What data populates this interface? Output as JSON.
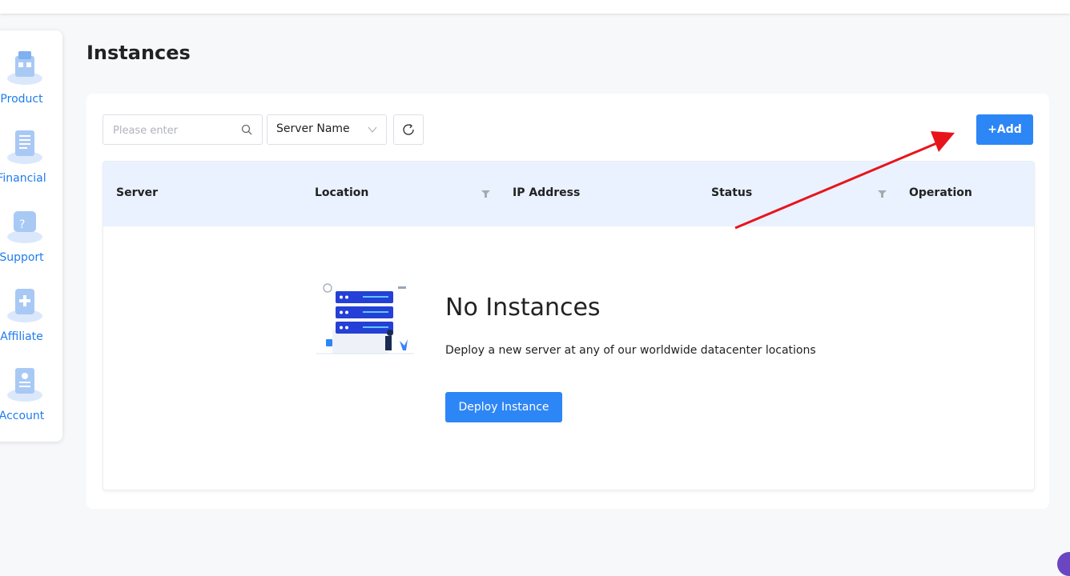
{
  "page": {
    "title": "Instances"
  },
  "sidebar": {
    "items": [
      {
        "label": "Product",
        "icon": "product-icon"
      },
      {
        "label": "Financial",
        "icon": "financial-icon"
      },
      {
        "label": "Support",
        "icon": "support-icon"
      },
      {
        "label": "Affiliate",
        "icon": "affiliate-icon"
      },
      {
        "label": "Account",
        "icon": "account-icon"
      }
    ]
  },
  "toolbar": {
    "search_placeholder": "Please enter",
    "filter_select_value": "Server Name",
    "add_label": "+Add"
  },
  "table": {
    "columns": [
      "Server",
      "Location",
      "IP Address",
      "Status",
      "Operation"
    ]
  },
  "empty_state": {
    "title": "No Instances",
    "description": "Deploy a new server at any of our worldwide datacenter locations",
    "button_label": "Deploy Instance"
  },
  "colors": {
    "accent": "#2d86f5",
    "sidebar_label": "#1f7cf0",
    "table_header_bg": "#e9f2fe",
    "annotation_arrow": "#e8141c"
  }
}
